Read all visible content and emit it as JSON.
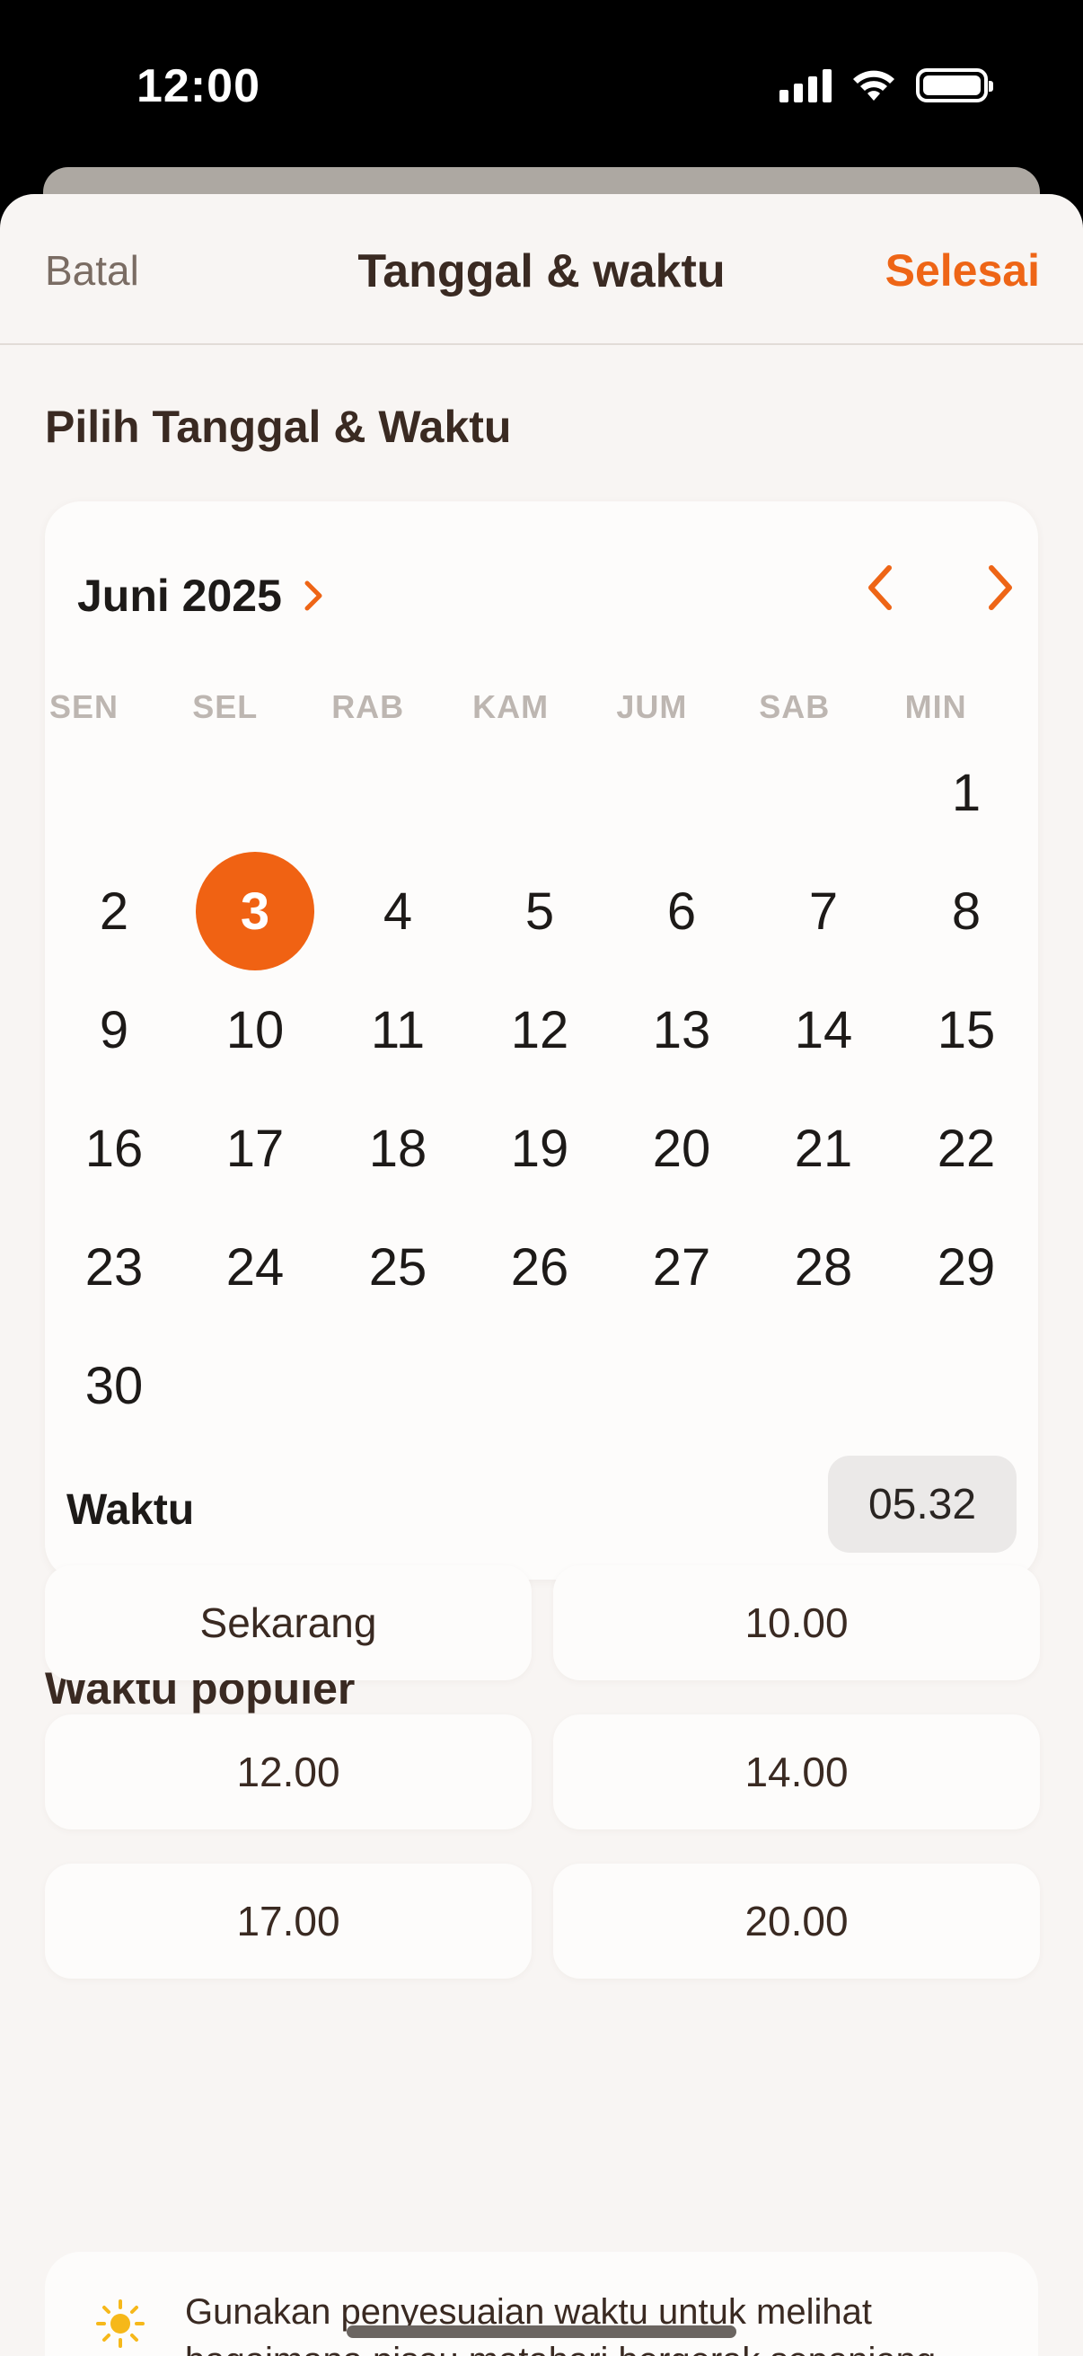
{
  "status_bar": {
    "time": "12:00"
  },
  "nav": {
    "cancel": "Batal",
    "title": "Tanggal & waktu",
    "done": "Selesai"
  },
  "section_pick": "Pilih Tanggal & Waktu",
  "calendar": {
    "month_label": "Juni 2025",
    "weekdays": [
      "SEN",
      "SEL",
      "RAB",
      "KAM",
      "JUM",
      "SAB",
      "MIN"
    ],
    "days": [
      "1",
      "2",
      "3",
      "4",
      "5",
      "6",
      "7",
      "8",
      "9",
      "10",
      "11",
      "12",
      "13",
      "14",
      "15",
      "16",
      "17",
      "18",
      "19",
      "20",
      "21",
      "22",
      "23",
      "24",
      "25",
      "26",
      "27",
      "28",
      "29",
      "30"
    ],
    "first_day_column": 6,
    "selected_day": "3",
    "time_label": "Waktu",
    "time_value": "05.32"
  },
  "section_popular": "Waktu populer",
  "popular_times": [
    "Sekarang",
    "10.00",
    "12.00",
    "14.00",
    "17.00",
    "20.00"
  ],
  "info": {
    "text": "Gunakan penyesuaian waktu untuk melihat bagaimana pisau matahari bergerak sepanjang"
  },
  "colors": {
    "accent": "#f06213",
    "background": "#f8f5f3",
    "card": "#fdfcfb"
  }
}
